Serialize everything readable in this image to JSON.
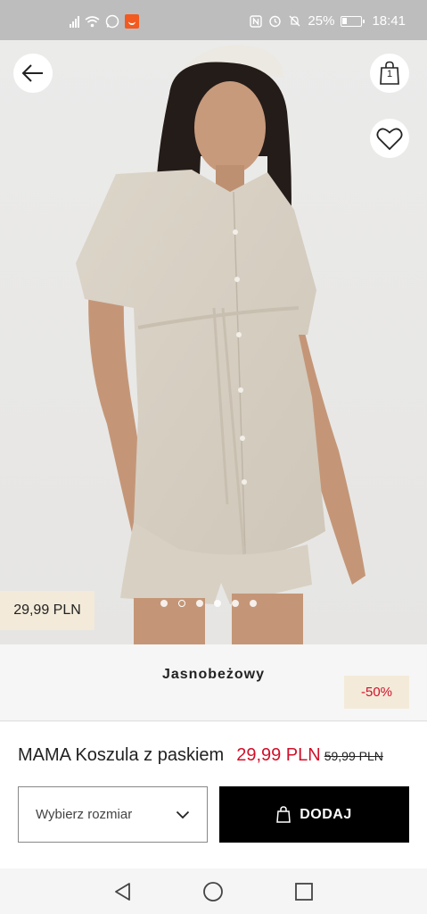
{
  "status_bar": {
    "battery": "25%",
    "time": "18:41"
  },
  "product": {
    "image_price": "29,99 PLN",
    "color_name": "Jasnobeżowy",
    "discount_badge": "-50%",
    "name": "MAMA Koszula z paskiem",
    "price_now": "29,99 PLN",
    "price_old": "59,99 PLN"
  },
  "actions": {
    "size_placeholder": "Wybierz rozmiar",
    "add_label": "DODAJ",
    "bag_count": "1"
  },
  "carousel": {
    "total": 6,
    "active_index": 1
  },
  "icons": {
    "back": "arrow-left-icon",
    "bag": "shopping-bag-icon",
    "favorite": "heart-icon",
    "dropdown": "chevron-down-icon",
    "add_bag": "bag-icon",
    "nav_back": "triangle-back-icon",
    "nav_home": "circle-home-icon",
    "nav_recent": "square-recent-icon"
  },
  "colors": {
    "accent_red": "#d0102a",
    "tag_bg": "#f3ead9",
    "button_black": "#000000"
  }
}
